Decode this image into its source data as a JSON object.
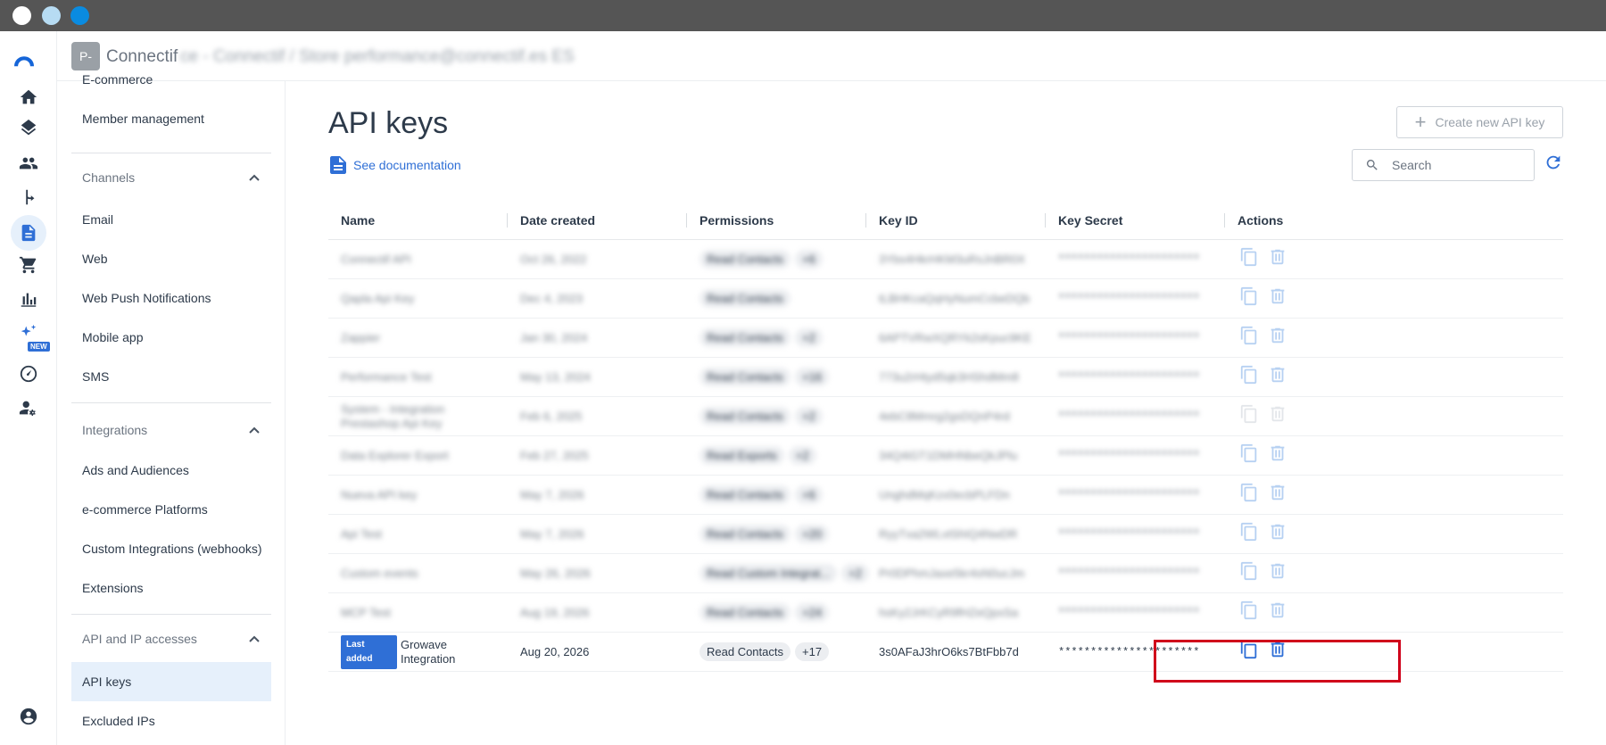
{
  "window": {
    "controls": [
      "close",
      "minimize",
      "maximize"
    ]
  },
  "rail": {
    "items": [
      {
        "icon": "home-icon"
      },
      {
        "icon": "layers-icon"
      },
      {
        "icon": "people-icon"
      },
      {
        "icon": "workflow-icon"
      },
      {
        "icon": "document-icon",
        "active": true
      },
      {
        "icon": "cart-icon"
      },
      {
        "icon": "bar-chart-icon"
      },
      {
        "icon": "sparkle-icon",
        "badge": "NEW"
      },
      {
        "icon": "speedometer-icon"
      },
      {
        "icon": "user-settings-icon"
      }
    ],
    "bottom_icon": "account-circle-icon"
  },
  "header": {
    "badge": "P-",
    "account": "Connectif",
    "account_blurred": "ce - Connectif / Store performance@connectif.es ES"
  },
  "sidebar": {
    "top_items": [
      "E-commerce",
      "Member management"
    ],
    "channels": {
      "label": "Channels",
      "items": [
        "Email",
        "Web",
        "Web Push Notifications",
        "Mobile app",
        "SMS"
      ]
    },
    "integrations": {
      "label": "Integrations",
      "items": [
        "Ads and Audiences",
        "e-commerce Platforms",
        "Custom Integrations (webhooks)",
        "Extensions"
      ]
    },
    "api": {
      "label": "API and IP accesses",
      "items": [
        "API keys",
        "Excluded IPs"
      ]
    }
  },
  "main": {
    "title": "API keys",
    "doc_link": "See documentation",
    "create_button": "Create new API key",
    "search_placeholder": "Search",
    "columns": [
      "Name",
      "Date created",
      "Permissions",
      "Key ID",
      "Key Secret",
      "Actions"
    ],
    "rows": [
      {
        "name": "Connectif API",
        "date": "Oct 26, 2022",
        "perm": "Read Contacts",
        "more": "+6",
        "key_id": "3Ybs4HkrHKM3uRsJnBR0X",
        "secret": "**********************",
        "blurred": true
      },
      {
        "name": "Qapla Api Key",
        "date": "Dec 4, 2023",
        "perm": "Read Contacts",
        "more": "",
        "key_id": "tLBHKcaQqHyNumCcbeDQb",
        "secret": "**********************",
        "blurred": true
      },
      {
        "name": "Zappier",
        "date": "Jan 30, 2024",
        "perm": "Read Contacts",
        "more": "+2",
        "key_id": "6APTVRwXQRYk2sKpuc9KE",
        "secret": "**********************",
        "blurred": true
      },
      {
        "name": "Performance Test",
        "date": "May 13, 2024",
        "perm": "Read Contacts",
        "more": "+16",
        "key_id": "773u2rHtyd5qk3HShdMm8",
        "secret": "**********************",
        "blurred": true
      },
      {
        "name": "System - Integration Prestashop Api Key",
        "date": "Feb 6, 2025",
        "perm": "Read Contacts",
        "more": "+2",
        "key_id": "4ebC8Mmrg2gsDQnP4rd",
        "secret": "**********************",
        "blurred": true,
        "disabled_actions": true
      },
      {
        "name": "Data Explorer Export",
        "date": "Feb 27, 2025",
        "perm": "Read Exports",
        "more": "+2",
        "key_id": "34Q4iGT1DMHNbeQkJPlu",
        "secret": "**********************",
        "blurred": true
      },
      {
        "name": "Nueva API key",
        "date": "May 7, 2026",
        "perm": "Read Contacts",
        "more": "+6",
        "key_id": "UnghdMqKzx0ecbPLFDn",
        "secret": "**********************",
        "blurred": true
      },
      {
        "name": "Api Test",
        "date": "May 7, 2026",
        "perm": "Read Contacts",
        "more": "+20",
        "key_id": "RyyTxa2WLvtShIQ4NwDR",
        "secret": "**********************",
        "blurred": true
      },
      {
        "name": "Custom events",
        "date": "May 26, 2026",
        "perm": "Read Custom Integrat...",
        "more": "+2",
        "key_id": "Pr0DPhmJaxe5kr4sN0ucJm",
        "secret": "**********************",
        "blurred": true
      },
      {
        "name": "MCP Test",
        "date": "Aug 19, 2026",
        "perm": "Read Contacts",
        "more": "+24",
        "key_id": "hsKy2JrKCyR9fHZeQpxSa",
        "secret": "**********************",
        "blurred": true
      },
      {
        "name": "Growave Integration",
        "badge": "Last added",
        "date": "Aug 20, 2026",
        "perm": "Read Contacts",
        "more": "+17",
        "key_id": "3s0AFaJ3hrO6ks7BtFbb7d",
        "secret": "**********************",
        "blurred": false,
        "highlighted": true
      }
    ]
  },
  "colors": {
    "accent": "#2f6fd6",
    "highlight": "#d0021b",
    "active_bg": "#e6f0fb"
  }
}
